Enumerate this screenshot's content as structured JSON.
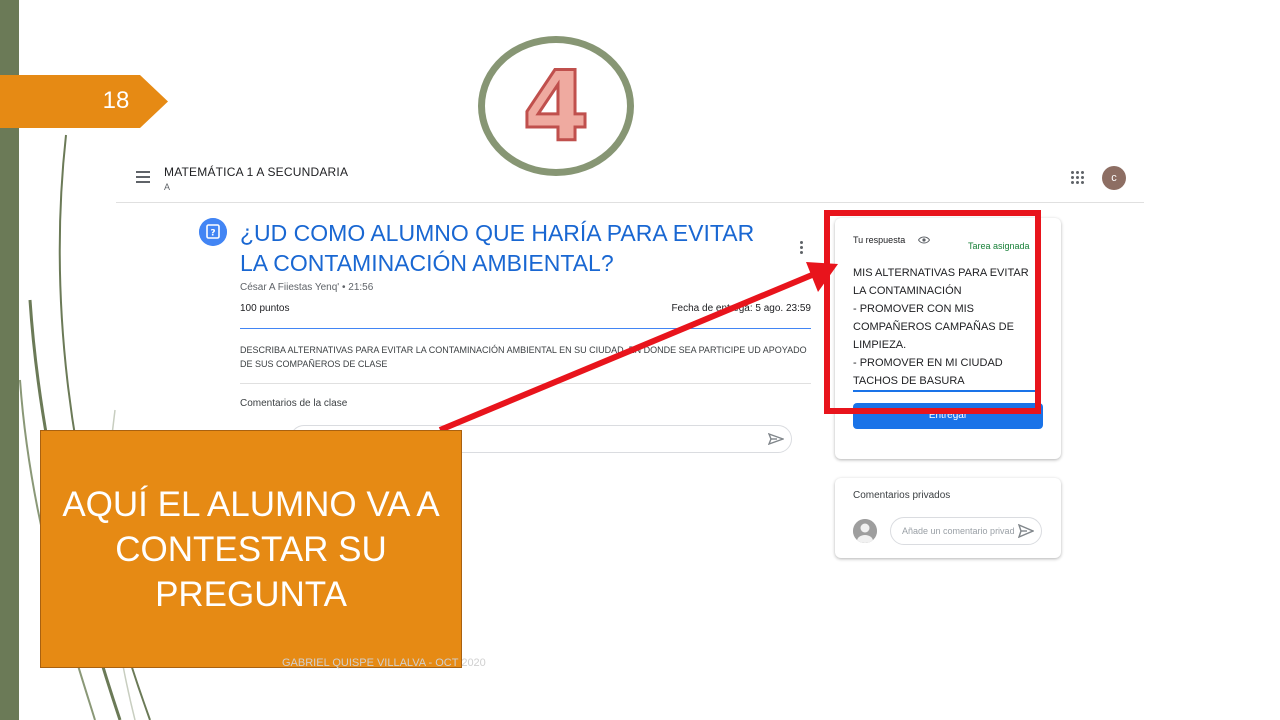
{
  "slide": {
    "number": "18",
    "step_number": "4",
    "footer": "GABRIEL QUISPE VILLALVA - OCT 2020"
  },
  "header": {
    "class_title": "MATEMÁTICA 1 A SECUNDARIA",
    "class_section": "A",
    "avatar_letter": "c"
  },
  "assignment": {
    "title": "¿UD COMO ALUMNO QUE HARÍA PARA EVITAR LA CONTAMINACIÓN AMBIENTAL?",
    "author": "César A Fiiestas Yenq' • 21:56",
    "points": "100 puntos",
    "due": "Fecha de entrega: 5 ago. 23:59",
    "instructions": "DESCRIBA ALTERNATIVAS PARA EVITAR LA CONTAMINACIÓN AMBIENTAL EN SU CIUDAD, EN DONDE SEA PARTICIPE UD APOYADO DE SUS COMPAÑEROS DE CLASE",
    "comments_label": "Comentarios de la clase"
  },
  "response": {
    "label": "Tu respuesta",
    "status": "Tarea asignada",
    "answer": "MIS ALTERNATIVAS PARA EVITAR\nLA CONTAMINACIÓN\n- PROMOVER CON MIS\nCOMPAÑEROS CAMPAÑAS DE\nLIMPIEZA.\n- PROMOVER EN MI CIUDAD\nTACHOS DE BASURA",
    "submit_label": "Entregar"
  },
  "private_comments": {
    "label": "Comentarios privados",
    "placeholder": "Añade un comentario privado"
  },
  "callout": {
    "text": "AQUÍ EL ALUMNO VA A CONTESTAR SU PREGUNTA"
  },
  "colors": {
    "accent_orange": "#e68a14",
    "highlight_red": "#e8141c",
    "classroom_blue": "#1a73e8",
    "slide_green": "#6b7a57"
  }
}
